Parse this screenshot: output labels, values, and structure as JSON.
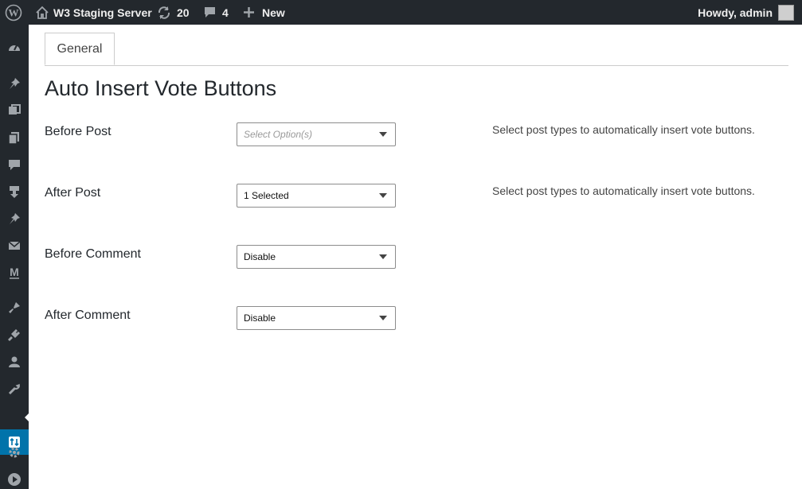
{
  "adminbar": {
    "site_name": "W3 Staging Server",
    "updates_count": "20",
    "comments_count": "4",
    "new_label": "New",
    "greeting": "Howdy, admin"
  },
  "sidebar": {
    "icons": [
      "dashboard-icon",
      "pin-icon",
      "media-icon",
      "pages-icon",
      "comments-icon",
      "download-icon",
      "pin-icon",
      "mail-icon",
      "m-icon",
      "appearance-icon",
      "plugins-icon",
      "users-icon",
      "tools-icon",
      "vote-icon",
      "settings-icon",
      "play-icon"
    ]
  },
  "tabs": [
    {
      "label": "General"
    }
  ],
  "page": {
    "title": "Auto Insert Vote Buttons",
    "rows": [
      {
        "label": "Before Post",
        "select_value": "Select Option(s)",
        "help": "Select post types to automatically insert vote buttons."
      },
      {
        "label": "After Post",
        "select_value": "1 Selected",
        "help": "Select post types to automatically insert vote buttons."
      },
      {
        "label": "Before Comment",
        "select_value": "Disable"
      },
      {
        "label": "After Comment",
        "select_value": "Disable"
      }
    ]
  },
  "colors": {
    "adminbar_bg": "#23282d",
    "active_menu": "#0073aa",
    "text": "#23282d"
  }
}
